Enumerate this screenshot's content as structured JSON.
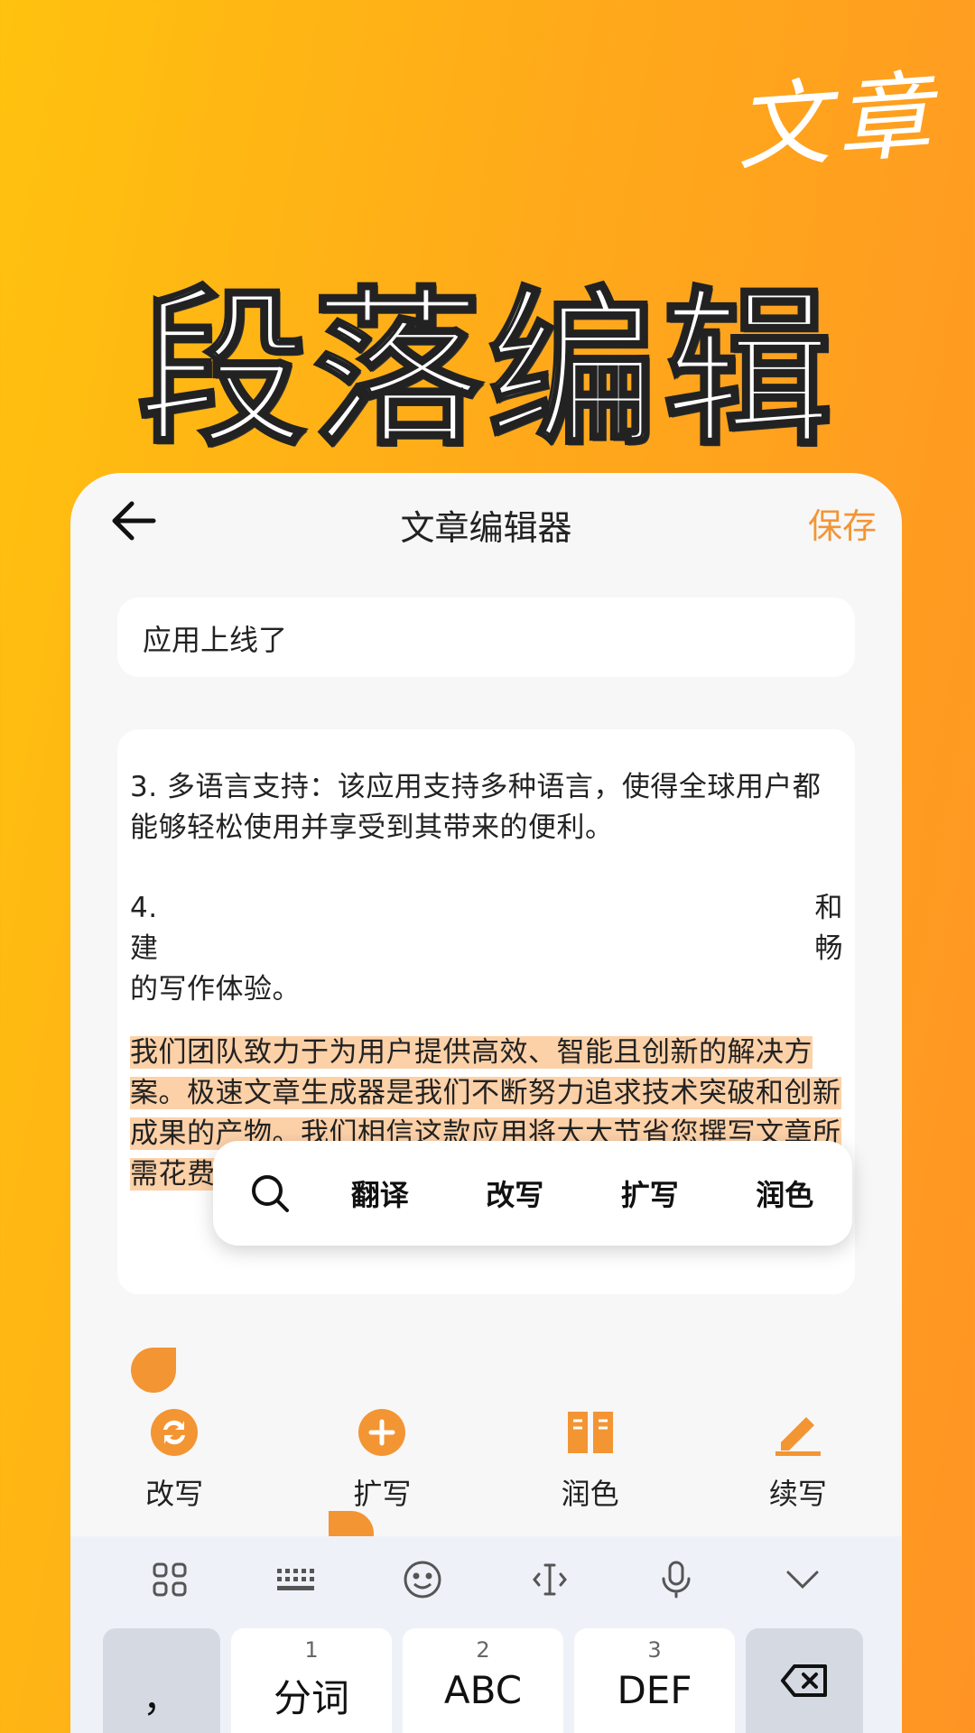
{
  "brand": "文章",
  "headline": "段落编辑",
  "app": {
    "title": "文章编辑器",
    "save_label": "保存",
    "title_field_value": "应用上线了"
  },
  "content": {
    "para1": "3. 多语言支持：该应用支持多种语言，使得全球用户都能够轻松使用并享受到其带来的便利。",
    "para2_line1_start": "4. ",
    "para2_line1_end": "和",
    "para2_line2_start": "建",
    "para2_line2_end": "畅",
    "para2_line3": "的写作体验。",
    "para3_selected": "我们团队致力于为用户提供高效、智能且创新的解决方案。极速文章生成器是我们不断努力追求技术突破和创新成果的产物。我们相信这款应用将大大节省您撰写文章所需花费的时间和精力，并为您带来更多灵感与创意。"
  },
  "popup": {
    "items": [
      "翻译",
      "改写",
      "扩写",
      "润色"
    ]
  },
  "tools": [
    {
      "label": "改写",
      "icon": "refresh-icon"
    },
    {
      "label": "扩写",
      "icon": "plus-icon"
    },
    {
      "label": "润色",
      "icon": "book-icon"
    },
    {
      "label": "续写",
      "icon": "pencil-icon"
    }
  ],
  "keyboard": {
    "toolbar_icons": [
      "grid-icon",
      "keyboard-icon",
      "emoji-icon",
      "cursor-icon",
      "mic-icon",
      "chevron-down-icon"
    ],
    "keys": [
      {
        "num": "",
        "label": "，"
      },
      {
        "num": "1",
        "label": "分词"
      },
      {
        "num": "2",
        "label": "ABC"
      },
      {
        "num": "3",
        "label": "DEF"
      }
    ]
  },
  "colors": {
    "accent": "#F39533",
    "highlight": "#FDD1A8",
    "background_start": "#FFC20E",
    "background_end": "#FF9424"
  }
}
